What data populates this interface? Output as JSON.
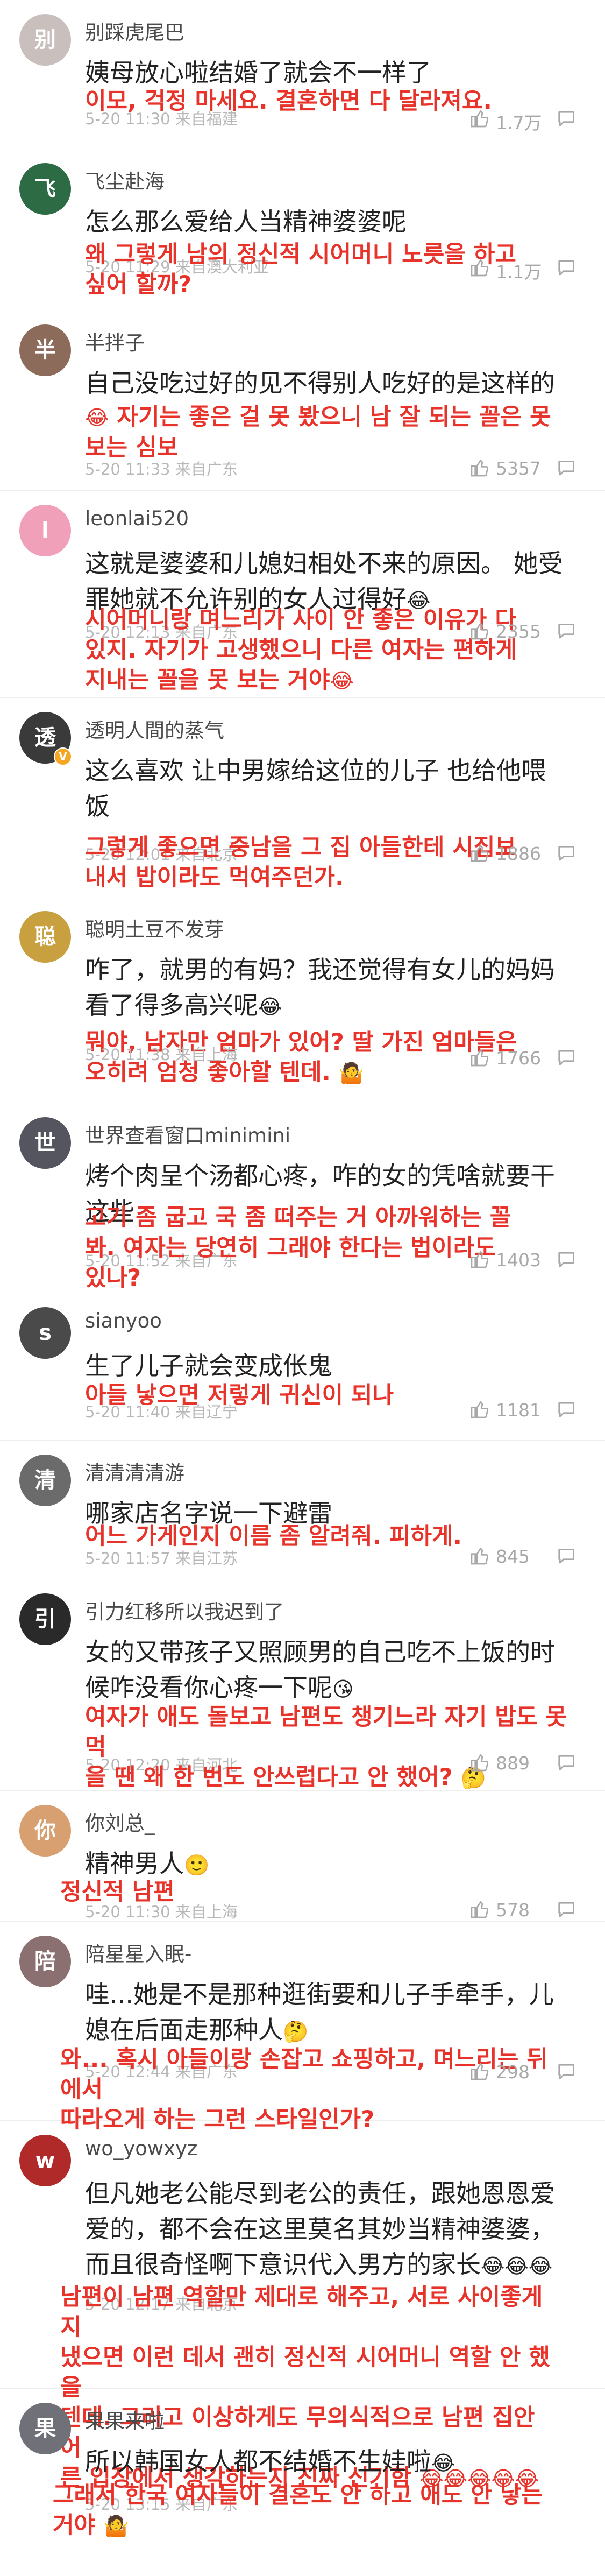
{
  "comments": [
    {
      "name": "别踩虎尾巴",
      "text": "姨母放心啦结婚了就会不一样了",
      "meta": "5-20 11:30 来自福建",
      "translation": "이모, 걱정 마세요. 결혼하면 다 달라져요.",
      "likes": "1.7万",
      "avatar_color": "#c9c0bd",
      "initial": "别"
    },
    {
      "name": "飞尘赴海",
      "text": "怎么那么爱给人当精神婆婆呢",
      "meta": "5-20 11:29 来自澳大利亚",
      "translation": "왜 그렇게 남의 정신적 시어머니 노릇을 하고\n싶어 할까?",
      "likes": "1.1万",
      "avatar_color": "#2d6b45",
      "initial": "飞"
    },
    {
      "name": "半拌子",
      "text": "自己没吃过好的见不得别人吃好的是这样的",
      "meta": "5-20 11:33 来自广东",
      "translation": "자기는 좋은 걸 못 봤으니 남 잘 되는 꼴은 못\n보는 심보",
      "likes": "5357",
      "avatar_color": "#8c6b5a",
      "initial": "半"
    },
    {
      "name": "leonlai520",
      "text": "这就是婆婆和儿媳妇相处不来的原因。 她受\n罪她就不允许别的女人过得好",
      "meta": "5-20 12:13 来自广东",
      "translation": "시어머니랑 며느리가 사이 안 좋은 이유가 다\n있지. 자기가 고생했으니 다른 여자는 편하게\n지내는 꼴을 못 보는 거야",
      "likes": "2355",
      "avatar_color": "#f0a0b8",
      "initial": "l"
    },
    {
      "name": "透明人間的蒸气",
      "text": "这么喜欢 让中男嫁给这位的儿子 也给他喂\n饭",
      "meta": "5-20 12:01 来自北京",
      "translation": "그렇게 좋으면 중남을 그 집 아들한테 시집보\n내서 밥이라도 먹여주던가.",
      "likes": "1886",
      "avatar_color": "#3a3a3a",
      "initial": "透",
      "verified": "V"
    },
    {
      "name": "聪明土豆不发芽",
      "text": "咋了，就男的有妈？我还觉得有女儿的妈妈\n看了得多高兴呢",
      "meta": "5-20 11:38 来自上海",
      "translation": "뭐야, 남자만 엄마가 있어? 딸 가진 엄마들은\n오히려 엄청 좋아할 텐데.",
      "likes": "1766",
      "avatar_color": "#c8a040",
      "initial": "聪"
    },
    {
      "name": "世界查看窗口minimini",
      "text": "烤个肉呈个汤都心疼，咋的女的凭啥就要干\n这些",
      "meta": "5-20 11:52 来自广东",
      "translation": "고기 좀 굽고 국 좀 떠주는 거 아까워하는 꼴\n봐. 여자는 당연히 그래야 한다는 법이라도\n있나?",
      "likes": "1403",
      "avatar_color": "#555560",
      "initial": "世"
    },
    {
      "name": "sianyoo",
      "text": "生了儿子就会变成伥鬼",
      "meta": "5-20 11:40 来自辽宁",
      "translation": "아들 낳으면 저렇게 귀신이 되나",
      "likes": "1181",
      "avatar_color": "#4a4a4a",
      "initial": "s"
    },
    {
      "name": "清清清清游",
      "text": "哪家店名字说一下避雷",
      "meta": "5-20 11:57 来自江苏",
      "translation": "어느 가게인지 이름 좀 알려줘. 피하게.",
      "likes": "845",
      "avatar_color": "#6b6b6b",
      "initial": "清"
    },
    {
      "name": "引力红移所以我迟到了",
      "text": "女的又带孩子又照顾男的自己吃不上饭的时\n候咋没看你心疼一下呢",
      "meta": "5-20 12:20 来自河北",
      "translation": "여자가 애도 돌보고 남편도 챙기느라 자기 밥도 못 먹\n을 땐 왜 한 번도 안쓰럽다고 안 했어?",
      "likes": "889",
      "avatar_color": "#2a2a2a",
      "initial": "引"
    },
    {
      "name": "你刘总_",
      "text": "精神男人",
      "meta": "5-20 11:30 来自上海",
      "translation": "정신적 남편",
      "likes": "578",
      "avatar_color": "#d8a070",
      "initial": "你"
    },
    {
      "name": "陪星星入眠-",
      "text": "哇...她是不是那种逛街要和儿子手牵手，儿\n媳在后面走那种人",
      "meta": "5-20 12:44 来自广东",
      "translation": "와... 혹시 아들이랑 손잡고 쇼핑하고, 며느리는 뒤에서\n따라오게 하는 그런 스타일인가?",
      "likes": "298",
      "avatar_color": "#8a7070",
      "initial": "陪"
    },
    {
      "name": "wo_yowxyz",
      "text": "但凡她老公能尽到老公的责任，跟她恩恩爱\n爱的，都不会在这里莫名其妙当精神婆婆，\n而且很奇怪啊下意识代入男方的家长",
      "meta": "5-20 12:17 来自北京",
      "translation": "남편이 남편 역할만 제대로 해주고, 서로 사이좋게 지\n냈으면 이런 데서 괜히 정신적 시어머니 역할 안 했을\n텐데. 그리고 이상하게도 무의식적으로 남편 집안 어\n른 입장에서 생각하는지 진짜 신기함",
      "likes": "",
      "avatar_color": "#b02a2a",
      "initial": "w"
    },
    {
      "name": "果果来啦",
      "text": "所以韩国女人都不结婚不生娃啦",
      "meta": "5-20 13:15 来自广东",
      "translation": "그래서 한국 여자들이 결혼도 안 하고 애도 안 낳는\n거야",
      "likes": "",
      "avatar_color": "#707078",
      "initial": "果"
    }
  ]
}
